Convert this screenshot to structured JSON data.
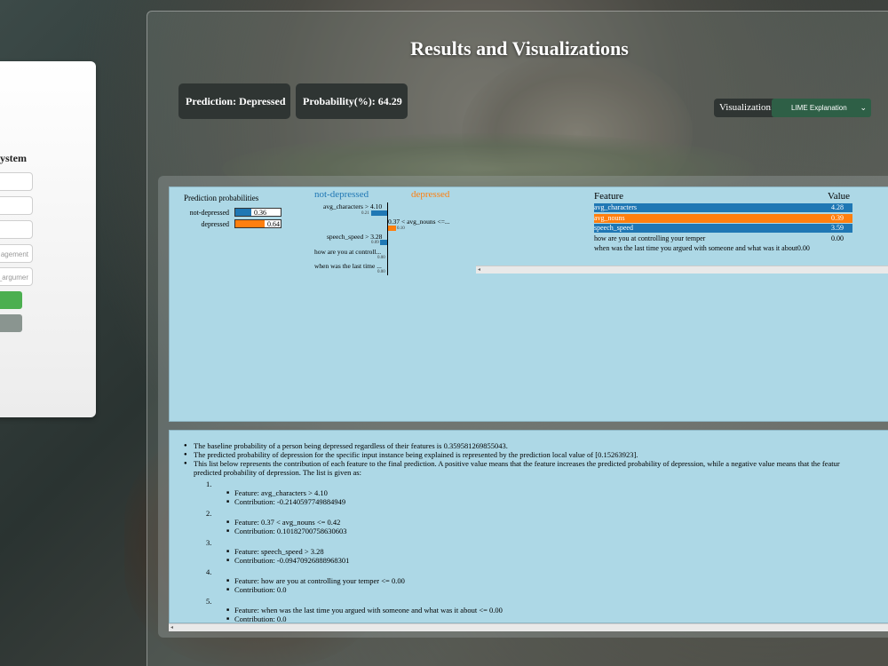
{
  "form": {
    "title_fragment": "ystem",
    "inputs": [
      "",
      "",
      "",
      "agement",
      "_argumer"
    ]
  },
  "header": {
    "title": "Results and Visualizations",
    "prediction": "Prediction: Depressed",
    "probability": "Probability(%): 64.29",
    "viz_label": "Visualization:",
    "viz_selected": "LIME Explanation",
    "chev_icon": "chevron-down-icon"
  },
  "lime": {
    "pp_title": "Prediction probabilities",
    "classes": [
      {
        "label": "not-depressed",
        "value": "0.36",
        "color": "#1f77b4"
      },
      {
        "label": "depressed",
        "value": "0.64",
        "color": "#ff7f0e"
      }
    ],
    "legend_neg": "not-depressed",
    "legend_pos": "depressed",
    "features": [
      {
        "label": "avg_characters > 4.10",
        "val": "0.21",
        "side": "neg",
        "w": 0.21
      },
      {
        "label": "0.37 < avg_nouns <=...",
        "val": "0.10",
        "side": "pos",
        "w": 0.1
      },
      {
        "label": "speech_speed > 3.28",
        "val": "0.09",
        "side": "neg",
        "w": 0.09
      },
      {
        "label": "how are you at controll...",
        "val": "0.00",
        "side": "neg",
        "w": 0.0
      },
      {
        "label": "when was the last time ...",
        "val": "0.00",
        "side": "neg",
        "w": 0.0
      }
    ],
    "table": {
      "head_feature": "Feature",
      "head_value": "Value",
      "rows": [
        {
          "f": "avg_characters",
          "v": "4.28",
          "color": "#1f77b4"
        },
        {
          "f": "avg_nouns",
          "v": "0.39",
          "color": "#ff7f0e"
        },
        {
          "f": "speech_speed",
          "v": "3.59",
          "color": "#1f77b4"
        },
        {
          "f": "how are you at controlling your temper",
          "v": "0.00",
          "color": ""
        },
        {
          "f": "when was the last time you argued with someone and what was it about",
          "v": "0.00",
          "color": ""
        }
      ]
    }
  },
  "explanation": {
    "bullets": [
      "The baseline probability of a person being depressed regardless of their features is 0.359581269855043.",
      "The predicted probability of depression for the specific input instance being explained is represented by the prediction local value of [0.15263923].",
      "This list below represents the contribution of each feature to the final prediction. A positive value means that the feature increases the predicted probability of depression, while a negative value means that the featur",
      "predicted probability of depression. The list is given as:"
    ],
    "items": [
      {
        "n": "1.",
        "feature": "Feature: avg_characters > 4.10",
        "contribution": "Contribution: -0.2140597749884949"
      },
      {
        "n": "2.",
        "feature": "Feature: 0.37 < avg_nouns <= 0.42",
        "contribution": "Contribution: 0.10182700758630603"
      },
      {
        "n": "3.",
        "feature": "Feature: speech_speed > 3.28",
        "contribution": "Contribution: -0.09470926888968301"
      },
      {
        "n": "4.",
        "feature": "Feature: how are you at controlling your temper <= 0.00",
        "contribution": "Contribution: 0.0"
      },
      {
        "n": "5.",
        "feature": "Feature: when was the last time you argued with someone and what was it about <= 0.00",
        "contribution": "Contribution: 0.0"
      }
    ]
  }
}
